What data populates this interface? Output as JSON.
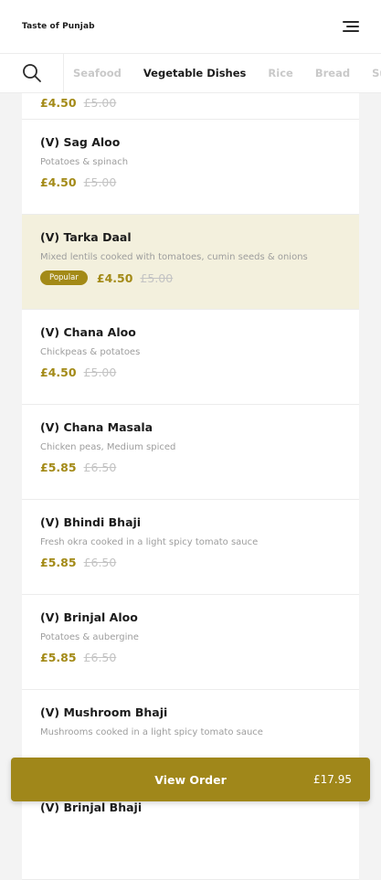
{
  "header": {
    "brand": "Taste of Punjab",
    "menu_icon": "hamburger-menu-icon"
  },
  "categories": {
    "search_icon": "search-icon",
    "items": [
      "Seafood",
      "Vegetable Dishes",
      "Rice",
      "Bread",
      "Sund"
    ],
    "active": "Vegetable Dishes"
  },
  "partial_item": {
    "price": "£4.50",
    "old_price": "£5.00"
  },
  "menu_items": [
    {
      "name": "(V) Sag Aloo",
      "desc": "Potatoes & spinach",
      "price": "£4.50",
      "old_price": "£5.00"
    },
    {
      "name": "(V) Tarka Daal",
      "desc": "Mixed lentils cooked with tomatoes, cumin seeds & onions",
      "badge": "Popular",
      "price": "£4.50",
      "old_price": "£5.00"
    },
    {
      "name": "(V) Chana Aloo",
      "desc": "Chickpeas & potatoes",
      "price": "£4.50",
      "old_price": "£5.00"
    },
    {
      "name": "(V) Chana Masala",
      "desc": "Chicken peas, Medium spiced",
      "price": "£5.85",
      "old_price": "£6.50"
    },
    {
      "name": "(V) Bhindi Bhaji",
      "desc": "Fresh okra cooked in a light spicy tomato sauce",
      "price": "£5.85",
      "old_price": "£6.50"
    },
    {
      "name": "(V) Brinjal Aloo",
      "desc": "Potatoes & aubergine",
      "price": "£5.85",
      "old_price": "£6.50"
    },
    {
      "name": "(V) Mushroom Bhaji",
      "desc": "Mushrooms cooked in a light spicy tomato sauce",
      "price": "",
      "old_price": ""
    },
    {
      "name": "(V) Brinjal Bhaji",
      "desc": "",
      "price": "",
      "old_price": ""
    }
  ],
  "view_order": {
    "label": "View Order",
    "total": "£17.95"
  },
  "colors": {
    "accent": "#a38a17",
    "highlight_row": "#f3f0dd"
  }
}
